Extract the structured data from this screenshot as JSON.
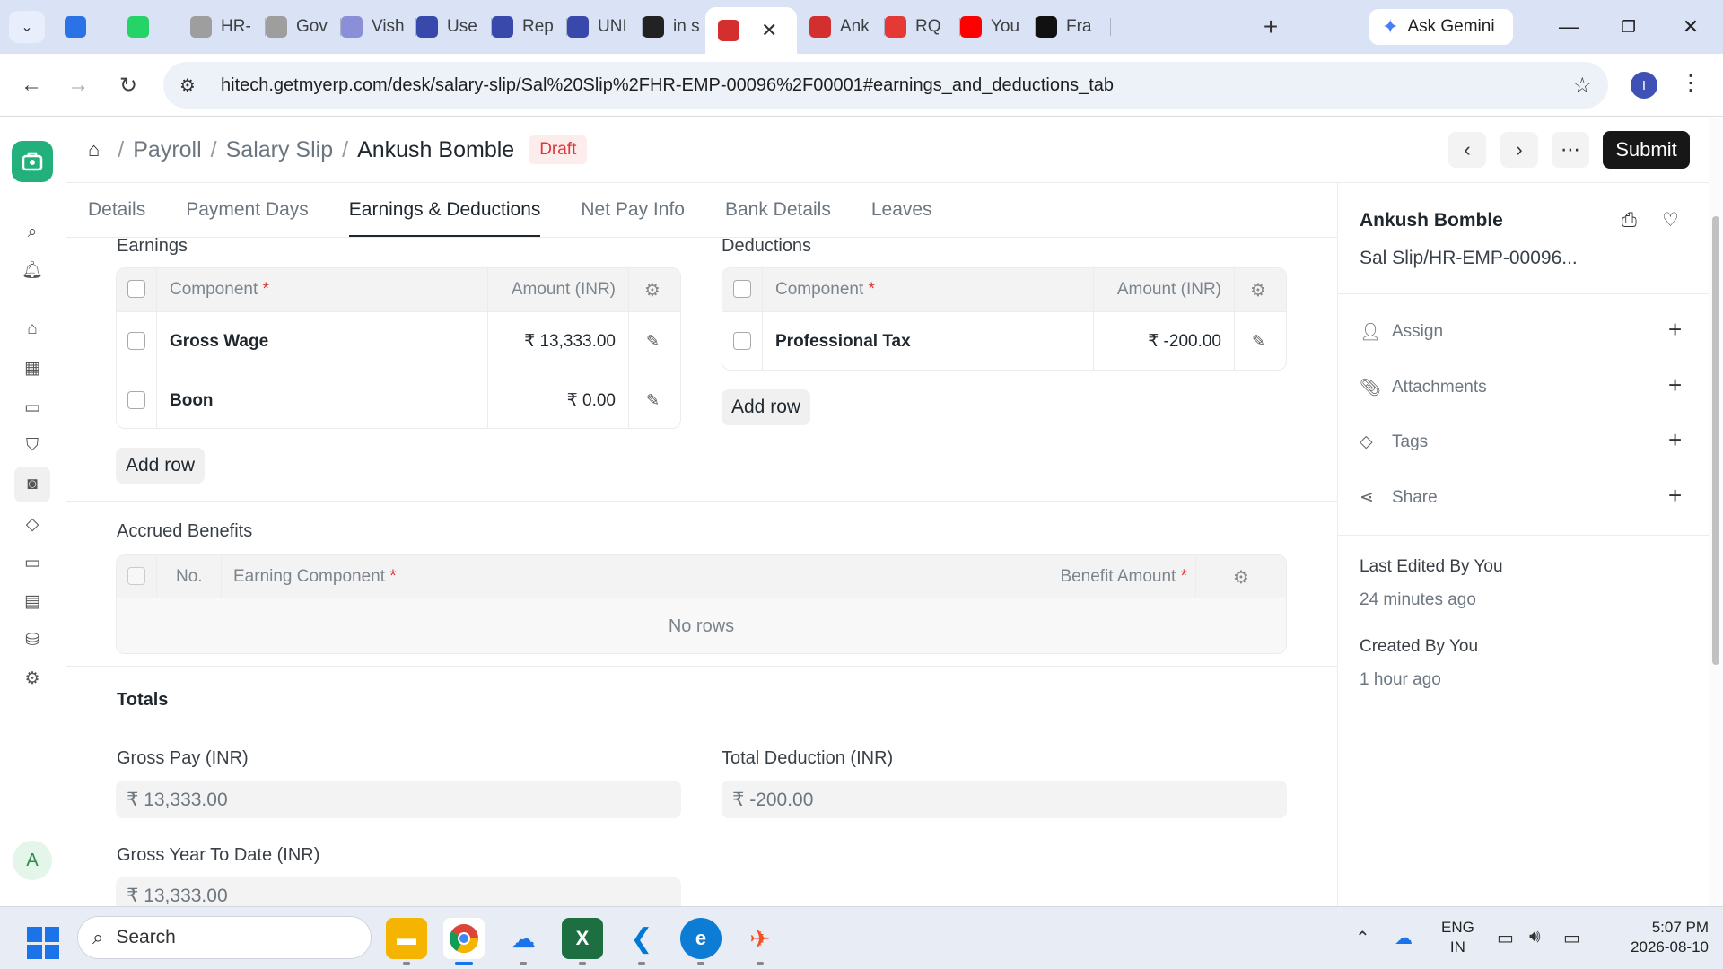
{
  "browser": {
    "tabs": [
      {
        "label": "",
        "icon": "chatgpt-icon",
        "color": "#2a72e5"
      },
      {
        "label": "",
        "icon": "whatsapp-icon",
        "color": "#25d366"
      },
      {
        "label": "HR-",
        "icon": "doc-icon",
        "color": "#9e9e9e"
      },
      {
        "label": "Gov",
        "icon": "doc-icon",
        "color": "#9e9e9e"
      },
      {
        "label": "Vish",
        "icon": "doc-icon",
        "color": "#8a8fd8"
      },
      {
        "label": "Use",
        "icon": "wax-icon",
        "color": "#3949ab"
      },
      {
        "label": "Rep",
        "icon": "wax-icon",
        "color": "#3949ab"
      },
      {
        "label": "UNI",
        "icon": "wax-icon",
        "color": "#3949ab"
      },
      {
        "label": "in s",
        "icon": "notion-icon",
        "color": "#222222"
      },
      {
        "label": "",
        "icon": "erp-icon",
        "color": "#d32f2f",
        "active": true
      },
      {
        "label": "Ank",
        "icon": "erp-icon",
        "color": "#d32f2f"
      },
      {
        "label": "RQ",
        "icon": "rq-icon",
        "color": "#e53935"
      },
      {
        "label": "You",
        "icon": "youtube-icon",
        "color": "#ff0000"
      },
      {
        "label": "Fra",
        "icon": "frappe-icon",
        "color": "#111111"
      }
    ],
    "ask_gemini": "Ask Gemini",
    "url": "hitech.getmyerp.com/desk/salary-slip/Sal%20Slip%2FHR-EMP-00096%2F00001#earnings_and_deductions_tab",
    "profile_initial": "I"
  },
  "header": {
    "breadcrumbs": [
      "Payroll",
      "Salary Slip"
    ],
    "title": "Ankush Bomble",
    "status": "Draft",
    "submit_label": "Submit"
  },
  "tabs": [
    "Details",
    "Payment Days",
    "Earnings & Deductions",
    "Net Pay Info",
    "Bank Details",
    "Leaves"
  ],
  "active_tab": "Earnings & Deductions",
  "earnings": {
    "label": "Earnings",
    "col_component": "Component",
    "col_amount": "Amount (INR)",
    "rows": [
      {
        "component": "Gross Wage",
        "amount": "₹ 13,333.00"
      },
      {
        "component": "Boon",
        "amount": "₹ 0.00"
      }
    ],
    "add_row": "Add row"
  },
  "deductions": {
    "label": "Deductions",
    "col_component": "Component",
    "col_amount": "Amount (INR)",
    "rows": [
      {
        "component": "Professional Tax",
        "amount": "₹ -200.00"
      }
    ],
    "add_row": "Add row"
  },
  "accrued": {
    "label": "Accrued Benefits",
    "col_no": "No.",
    "col_component": "Earning Component",
    "col_amount": "Benefit Amount",
    "empty": "No rows"
  },
  "totals": {
    "label": "Totals",
    "gross_pay_label": "Gross Pay (INR)",
    "gross_pay_value": "₹ 13,333.00",
    "total_deduction_label": "Total Deduction (INR)",
    "total_deduction_value": "₹ -200.00",
    "gross_ytd_label": "Gross Year To Date (INR)",
    "gross_ytd_value": "₹ 13,333.00"
  },
  "sidebar": {
    "name": "Ankush Bomble",
    "doc_id": "Sal Slip/HR-EMP-00096...",
    "items": [
      "Assign",
      "Attachments",
      "Tags",
      "Share"
    ],
    "last_edited_label": "Last Edited By You",
    "last_edited_time": "24 minutes ago",
    "created_label": "Created By You",
    "created_time": "1 hour ago"
  },
  "app": {
    "user_initial": "A"
  },
  "taskbar": {
    "search_placeholder": "Search",
    "lang_1": "ENG",
    "lang_2": "IN",
    "time": "5:07 PM",
    "date": "2026-08-10"
  },
  "colors": {
    "submit_bg": "#171717",
    "draft_bg": "#fdecec",
    "draft_fg": "#e03636",
    "logo_green": "#22b07d",
    "required_red": "#e03636"
  }
}
